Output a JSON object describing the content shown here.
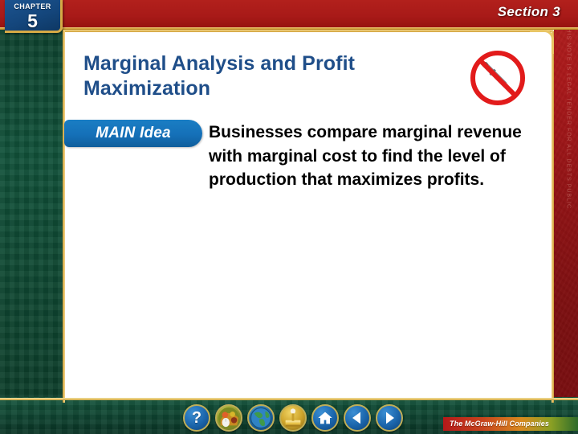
{
  "slide": {
    "chapter": {
      "label": "CHAPTER",
      "number": "5"
    },
    "section": {
      "label": "Section 3"
    },
    "title": "Marginal Analysis and Profit Maximization",
    "main_idea": {
      "badge_label": "MAIN Idea",
      "text": "Businesses compare marginal revenue with marginal cost to find the level of production that maximizes profits."
    },
    "status_icon": {
      "name": "no-pen-icon"
    }
  },
  "toolbar": {
    "buttons": [
      {
        "name": "help-button",
        "icon": "question-mark-icon",
        "glyph": "?",
        "style": "blue"
      },
      {
        "name": "media-button",
        "icon": "multimedia-icon",
        "glyph": "",
        "style": "media"
      },
      {
        "name": "web-resources-button",
        "icon": "globe-icon",
        "glyph": "",
        "style": "globe"
      },
      {
        "name": "activity-button",
        "icon": "joystick-icon",
        "glyph": "",
        "style": "gold"
      },
      {
        "name": "home-button",
        "icon": "home-icon",
        "glyph": "⌂",
        "style": "blue"
      },
      {
        "name": "previous-button",
        "icon": "left-arrow-icon",
        "glyph": "◀",
        "style": "blue"
      },
      {
        "name": "next-button",
        "icon": "right-arrow-icon",
        "glyph": "▶",
        "style": "blue"
      }
    ],
    "publisher": "The McGraw-Hill Companies"
  },
  "colors": {
    "title_blue": "#1f4e89",
    "badge_blue": "#1570b8",
    "background_red": "#a8181a",
    "toolbar_green": "#0e4330",
    "gold_rule": "#d6aa45"
  }
}
